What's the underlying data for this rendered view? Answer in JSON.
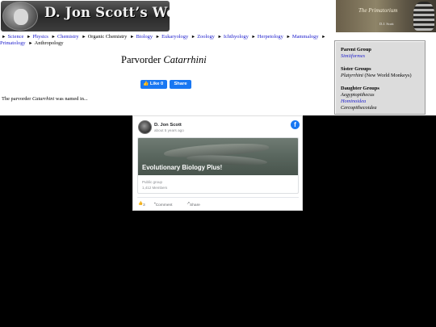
{
  "header": {
    "site_title": "D. Jon Scott’s Website",
    "primatorium_title": "The Primatorium",
    "primatorium_sub": "D.J. Scott"
  },
  "breadcrumb": [
    {
      "label": "Science",
      "link": true
    },
    {
      "label": "Physics",
      "link": true
    },
    {
      "label": "Chemistry",
      "link": true
    },
    {
      "label": "Organic Chemistry",
      "link": false
    },
    {
      "label": "Biology",
      "link": true
    },
    {
      "label": "Eukaryology",
      "link": true
    },
    {
      "label": "Zoology",
      "link": true
    },
    {
      "label": "Ichthyology",
      "link": true
    },
    {
      "label": "Herpetology",
      "link": true
    },
    {
      "label": "Mammalogy",
      "link": true
    },
    {
      "label": "Primatology",
      "link": true
    },
    {
      "label": "Anthropology",
      "link": false
    }
  ],
  "main": {
    "title_prefix": "Parvorder",
    "title_taxon": "Catarrhini",
    "like_label": "Like 0",
    "share_label": "Share",
    "named_prefix": "The parvorder",
    "named_taxon": "Catarrhini",
    "named_suffix": "was named in..."
  },
  "sidebar": {
    "parent_heading": "Parent Group",
    "parent": "Simiiformes",
    "sister_heading": "Sister Groups",
    "sister_taxon": "Platyrrhini",
    "sister_common": "(New World Monkeys)",
    "daughter_heading": "Daughter Groups",
    "daughters": [
      {
        "label": "Aegyptopithecus",
        "link": false
      },
      {
        "label": "Hominoidea",
        "link": true
      },
      {
        "label": "Cercopithecoidea",
        "link": false
      }
    ]
  },
  "fbcard": {
    "name": "D. Jon Scott",
    "time": "about 5 years ago",
    "group_title": "Evolutionary Biology Plus!",
    "public": "Public group",
    "members": "1,412 Members",
    "like_count": "3",
    "comment_label": "Comment",
    "share_label": "Share"
  },
  "colors": {
    "link": "#1a1acc",
    "fb_blue": "#1877f2",
    "sidebar_bg": "#dcdcdc"
  }
}
